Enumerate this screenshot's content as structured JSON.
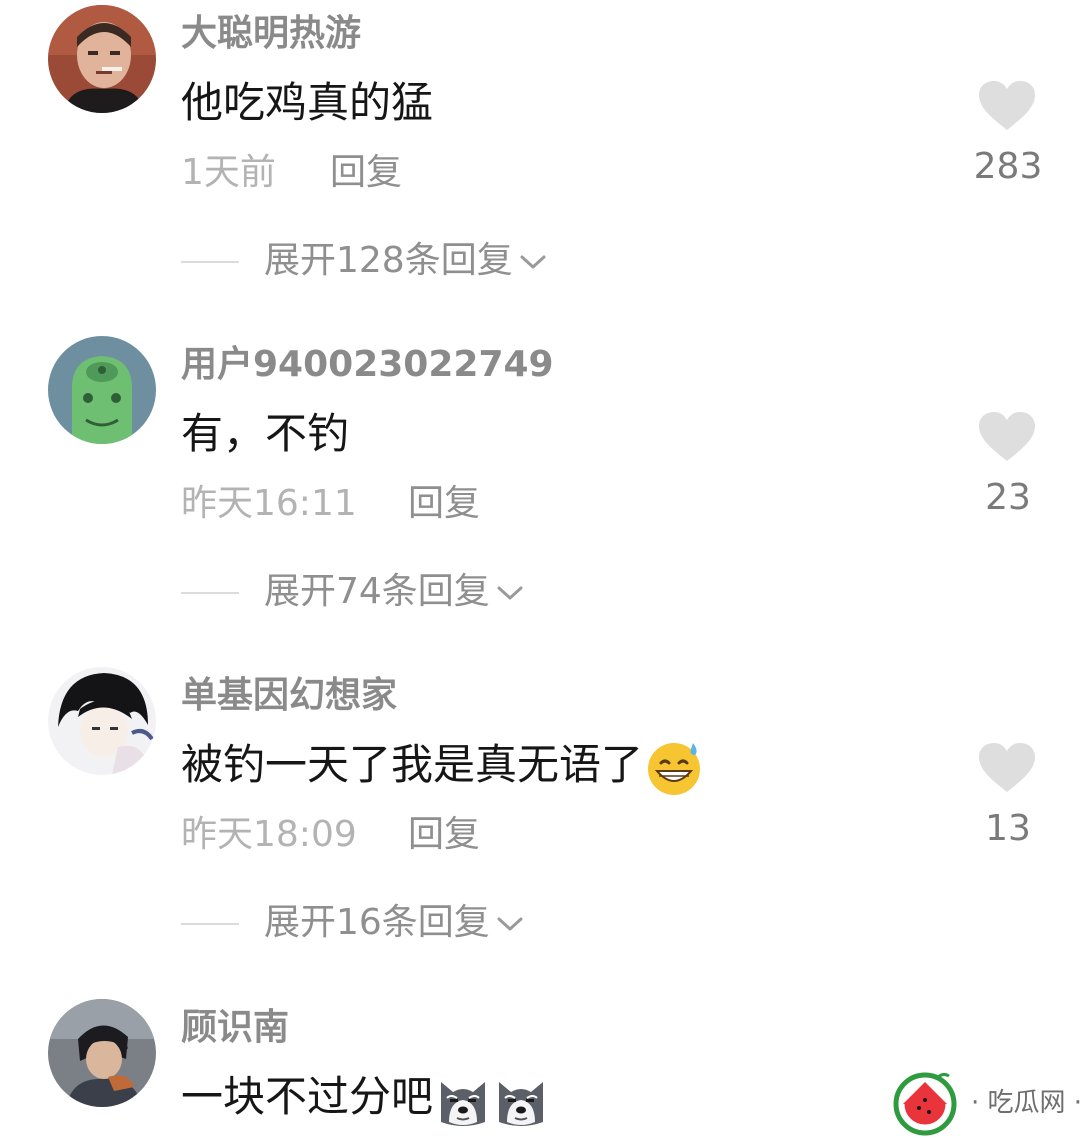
{
  "comments": [
    {
      "username": "大聪明热游",
      "content": "他吃鸡真的猛",
      "time": "1天前",
      "reply_label": "回复",
      "likes": "283",
      "expand_label": "展开128条回复"
    },
    {
      "username": "用户940023022749",
      "content": "有，不钓",
      "time": "昨天16:11",
      "reply_label": "回复",
      "likes": "23",
      "expand_label": "展开74条回复"
    },
    {
      "username": "单基因幻想家",
      "content": "被钓一天了我是真无语了",
      "content_emoji": "grinning-sweat-emoji",
      "time": "昨天18:09",
      "reply_label": "回复",
      "likes": "13",
      "expand_label": "展开16条回复"
    },
    {
      "username": "顾识南",
      "content": "一块不过分吧",
      "content_emoji": "husky-dog-emoji"
    }
  ],
  "watermark": {
    "text": "· 吃瓜网 ·",
    "icon": "watermelon-icon"
  },
  "colors": {
    "username": "#8a8a8a",
    "content": "#161616",
    "meta": "#b3b3b3",
    "heart": "#dedede",
    "watermelon_red": "#e8343a",
    "watermelon_green": "#2e9b3e"
  }
}
